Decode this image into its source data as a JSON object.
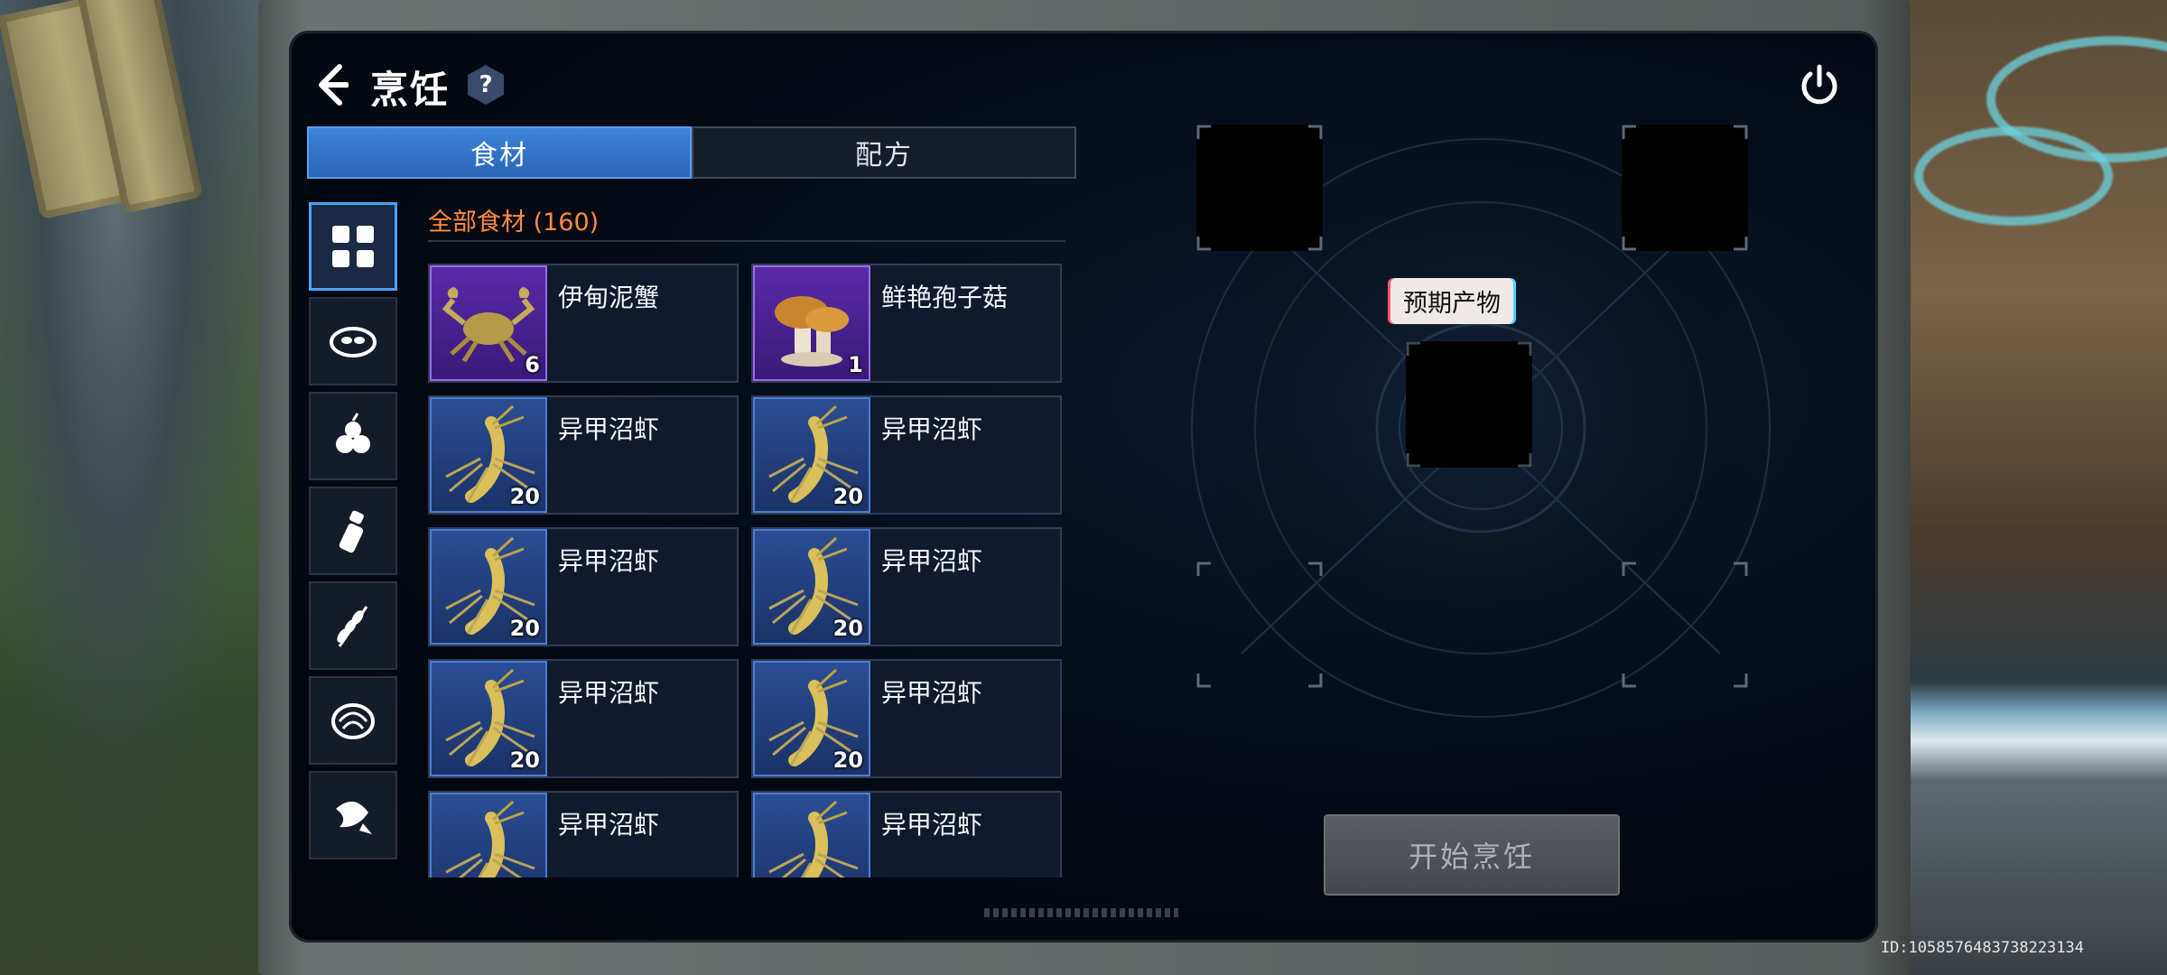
{
  "header": {
    "title": "烹饪",
    "help_glyph": "?"
  },
  "tabs": [
    {
      "label": "食材",
      "active": true
    },
    {
      "label": "配方",
      "active": false
    }
  ],
  "categories": [
    {
      "icon": "grid-all-icon",
      "active": true
    },
    {
      "icon": "meat-icon",
      "active": false
    },
    {
      "icon": "fruit-icon",
      "active": false
    },
    {
      "icon": "seasoning-icon",
      "active": false
    },
    {
      "icon": "grain-icon",
      "active": false
    },
    {
      "icon": "shellfish-icon",
      "active": false
    },
    {
      "icon": "fish-icon",
      "active": false
    }
  ],
  "ingredients": {
    "section_title": "全部食材 (160)",
    "items": [
      {
        "name": "伊甸泥蟹",
        "count": "6",
        "rarity": "purple",
        "icon": "crab-icon"
      },
      {
        "name": "鲜艳孢子菇",
        "count": "1",
        "rarity": "purple",
        "icon": "mushroom-icon"
      },
      {
        "name": "异甲沼虾",
        "count": "20",
        "rarity": "blue",
        "icon": "shrimp-icon"
      },
      {
        "name": "异甲沼虾",
        "count": "20",
        "rarity": "blue",
        "icon": "shrimp-icon"
      },
      {
        "name": "异甲沼虾",
        "count": "20",
        "rarity": "blue",
        "icon": "shrimp-icon"
      },
      {
        "name": "异甲沼虾",
        "count": "20",
        "rarity": "blue",
        "icon": "shrimp-icon"
      },
      {
        "name": "异甲沼虾",
        "count": "20",
        "rarity": "blue",
        "icon": "shrimp-icon"
      },
      {
        "name": "异甲沼虾",
        "count": "20",
        "rarity": "blue",
        "icon": "shrimp-icon"
      },
      {
        "name": "异甲沼虾",
        "count": "",
        "rarity": "blue",
        "icon": "shrimp-icon"
      },
      {
        "name": "异甲沼虾",
        "count": "",
        "rarity": "blue",
        "icon": "shrimp-icon"
      }
    ]
  },
  "cooking": {
    "expected_output_label": "预期产物",
    "start_button": "开始烹饪"
  },
  "session_id": "ID:1058576483738223134",
  "colors": {
    "accent": "#3e84d8",
    "section_title": "#ff8a3c",
    "rare_purple": "#5a2aa8",
    "rare_blue": "#2b4d94"
  }
}
